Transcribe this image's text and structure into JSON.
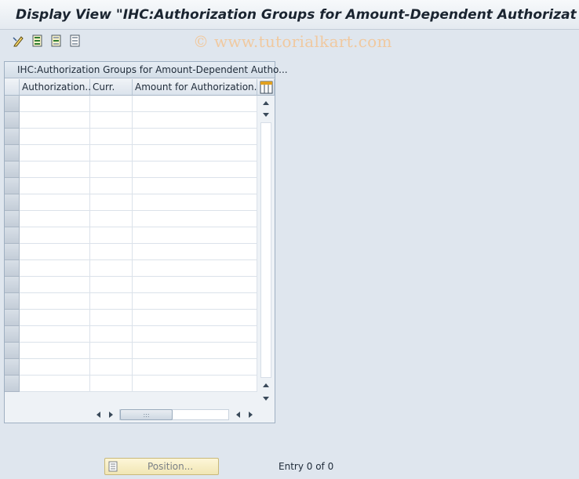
{
  "title": "Display View \"IHC:Authorization Groups for Amount-Dependent Authorizat",
  "toolbar": {
    "icons": [
      "change-display-icon",
      "select-all-icon",
      "select-block-icon",
      "deselect-all-icon"
    ]
  },
  "watermark": "© www.tutorialkart.com",
  "table": {
    "caption": "IHC:Authorization Groups for Amount-Dependent Autho...",
    "columns": [
      {
        "label": "Authorization..."
      },
      {
        "label": "Curr."
      },
      {
        "label": "Amount for Authorization..."
      }
    ],
    "rows": [
      [
        "",
        "",
        ""
      ],
      [
        "",
        "",
        ""
      ],
      [
        "",
        "",
        ""
      ],
      [
        "",
        "",
        ""
      ],
      [
        "",
        "",
        ""
      ],
      [
        "",
        "",
        ""
      ],
      [
        "",
        "",
        ""
      ],
      [
        "",
        "",
        ""
      ],
      [
        "",
        "",
        ""
      ],
      [
        "",
        "",
        ""
      ],
      [
        "",
        "",
        ""
      ],
      [
        "",
        "",
        ""
      ],
      [
        "",
        "",
        ""
      ],
      [
        "",
        "",
        ""
      ],
      [
        "",
        "",
        ""
      ],
      [
        "",
        "",
        ""
      ],
      [
        "",
        "",
        ""
      ],
      [
        "",
        "",
        ""
      ]
    ]
  },
  "footer": {
    "position_label": "Position...",
    "entry_text": "Entry 0 of 0"
  },
  "colors": {
    "background": "#dfe6ee",
    "position_button": "#f6edc4",
    "watermark": "#f0c9a0"
  }
}
